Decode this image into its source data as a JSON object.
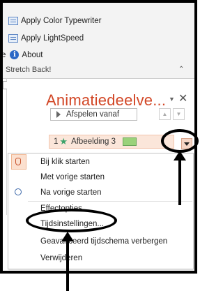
{
  "ribbon": {
    "items": [
      {
        "label": "Apply Color Typewriter",
        "icon": "addin-doc-icon"
      },
      {
        "label": "Apply LightSpeed",
        "icon": "addin-doc-icon"
      },
      {
        "label": "About",
        "icon": "info-icon",
        "prefix": "e"
      }
    ],
    "group_label": "Stretch Back!"
  },
  "pane": {
    "title": "Animatiedeelve...",
    "play_label": "Afspelen vanaf",
    "item": {
      "number": "1",
      "label": "Afbeelding 3",
      "swatch_color": "#9ad27a"
    }
  },
  "context_menu": {
    "items": [
      {
        "label": "Bij klik starten"
      },
      {
        "label": "Met vorige starten"
      },
      {
        "label": "Na vorige starten"
      },
      {
        "label": "Effectopties..."
      },
      {
        "label": "Tijdsinstellingen..."
      },
      {
        "label": "Geavanceerd tijdschema verbergen"
      },
      {
        "label": "Verwijderen"
      }
    ]
  },
  "colors": {
    "accent": "#d24726",
    "highlight_bg": "#fbe6da"
  }
}
